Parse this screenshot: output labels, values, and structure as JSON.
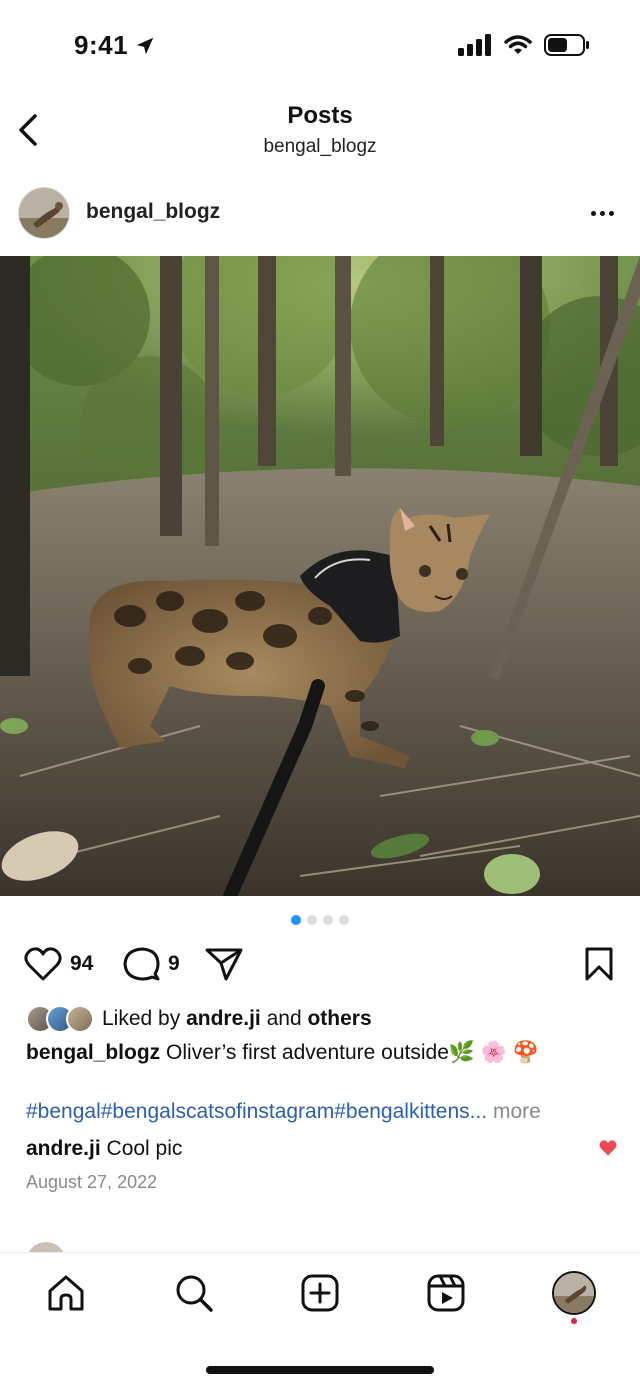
{
  "status_bar": {
    "time": "9:41",
    "icons": [
      "location-arrow-icon",
      "signal-icon",
      "wifi-icon",
      "battery-icon"
    ]
  },
  "header": {
    "title": "Posts",
    "subtitle": "bengal_blogz",
    "back_icon": "chevron-left-icon"
  },
  "post": {
    "username": "bengal_blogz",
    "more_icon": "more-horizontal-icon",
    "carousel": {
      "count": 4,
      "active_index": 0
    },
    "likes_count": "94",
    "comments_count": "9",
    "liked_by_prefix": "Liked by ",
    "liked_by_user": "andre.ji",
    "liked_by_and": " and ",
    "liked_by_others": "others",
    "caption_user": "bengal_blogz",
    "caption_text": " Oliver’s first adventure outside🌿 🌸 🍄",
    "hashtags": "#bengal#bengalscatsofinstagram#bengalkittens...",
    "more_label": " more",
    "comment_user": "andre.ji",
    "comment_text": " Cool pic",
    "date": "August 27, 2022"
  },
  "colors": {
    "accent_blue": "#1e90ff",
    "hashtag_blue": "#2b5fb3",
    "like_red": "#ed4956",
    "muted_gray": "#8a8a8a"
  },
  "tab_bar": {
    "items": [
      "home-icon",
      "search-icon",
      "create-icon",
      "reels-icon",
      "profile-avatar"
    ]
  }
}
